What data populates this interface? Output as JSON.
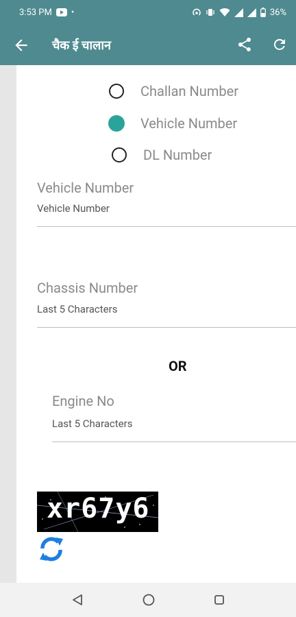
{
  "status_bar": {
    "time": "3:53 PM",
    "dot": "•",
    "battery": "36%",
    "icons": [
      "youtube-icon",
      "hotspot-icon",
      "vibrate-icon",
      "wifi-icon",
      "signal-icon",
      "signal-icon",
      "battery-icon"
    ]
  },
  "app_bar": {
    "title": "चैक ई चालान",
    "icons": [
      "back-arrow-icon",
      "share-icon",
      "refresh-icon"
    ]
  },
  "search_type": {
    "options": [
      {
        "label": "Challan Number",
        "selected": false
      },
      {
        "label": "Vehicle Number",
        "selected": true
      },
      {
        "label": "DL Number",
        "selected": false
      }
    ]
  },
  "vehicle_field": {
    "label": "Vehicle Number",
    "placeholder": "Vehicle Number"
  },
  "chassis_field": {
    "label": "Chassis Number",
    "placeholder": "Last 5 Characters"
  },
  "or_label": "OR",
  "engine_field": {
    "label": "Engine No",
    "placeholder": "Last 5 Characters"
  },
  "captcha": {
    "text": "xr67y6"
  },
  "colors": {
    "primary": "#4e8a8f",
    "accent": "#2aa39b",
    "refresh_icon": "#1f7fe0"
  }
}
